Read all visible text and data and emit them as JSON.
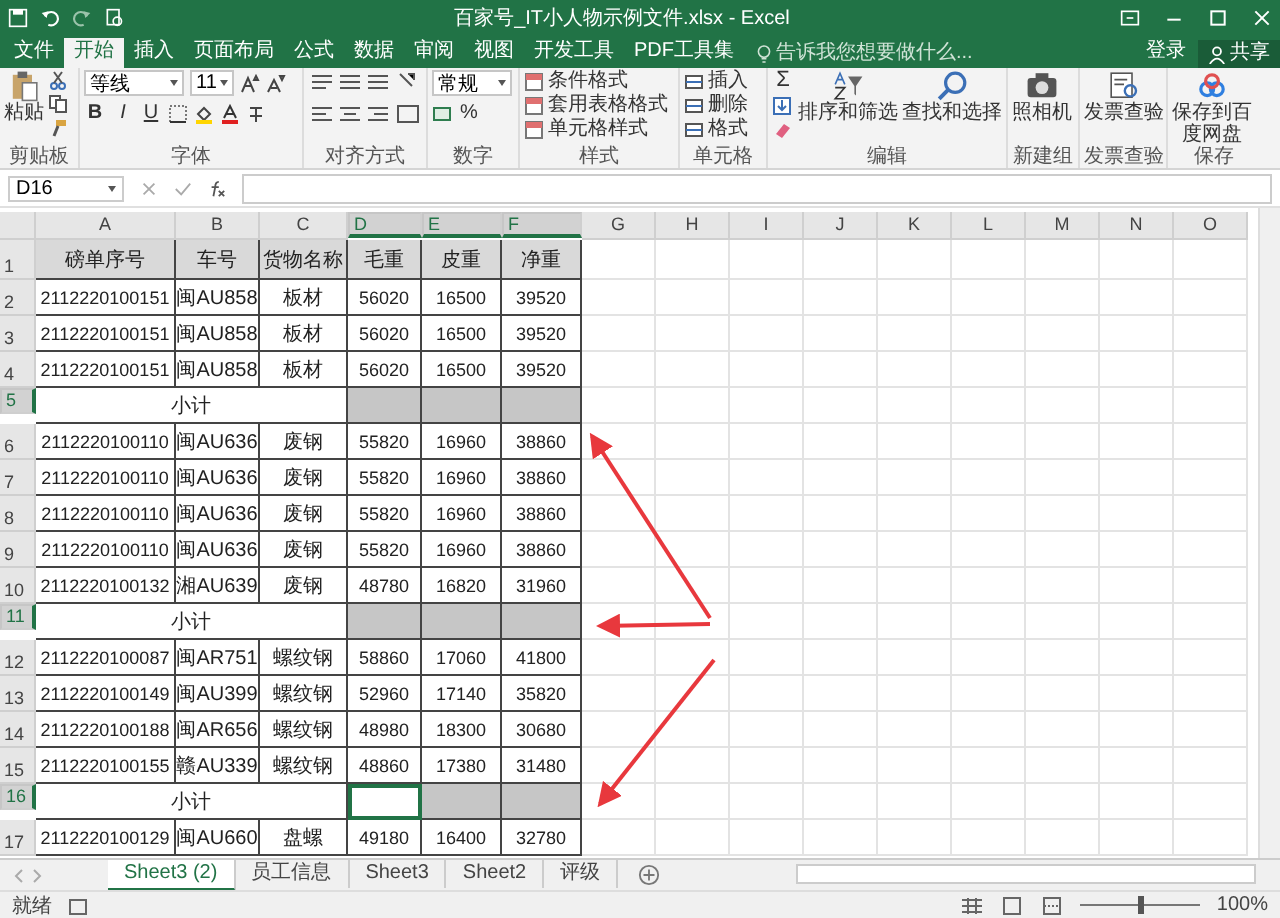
{
  "window": {
    "title": "百家号_IT小人物示例文件.xlsx - Excel"
  },
  "tabs": [
    {
      "label": "文件",
      "selected": false
    },
    {
      "label": "开始",
      "selected": true
    },
    {
      "label": "插入",
      "selected": false
    },
    {
      "label": "页面布局",
      "selected": false
    },
    {
      "label": "公式",
      "selected": false
    },
    {
      "label": "数据",
      "selected": false
    },
    {
      "label": "审阅",
      "selected": false
    },
    {
      "label": "视图",
      "selected": false
    },
    {
      "label": "开发工具",
      "selected": false
    },
    {
      "label": "PDF工具集",
      "selected": false
    }
  ],
  "tell_me": {
    "placeholder": "告诉我您想要做什么..."
  },
  "account": {
    "sign_in": "登录",
    "share": "共享"
  },
  "ribbon": {
    "clipboard": {
      "label": "剪贴板",
      "paste": "粘贴"
    },
    "font": {
      "label": "字体",
      "family": "等线",
      "size": "11",
      "bold": "B",
      "italic": "I",
      "underline": "U"
    },
    "alignment": {
      "label": "对齐方式"
    },
    "number": {
      "label": "数字",
      "format": "常规",
      "percent": "%"
    },
    "styles": {
      "label": "样式",
      "buttons": [
        "条件格式",
        "套用表格格式",
        "单元格样式"
      ]
    },
    "cells": {
      "label": "单元格",
      "buttons": [
        "插入",
        "删除",
        "格式"
      ]
    },
    "editing": {
      "label": "编辑",
      "sum": "Σ",
      "buttons": [
        "排序和筛选",
        "查找和选择"
      ]
    },
    "new_group": {
      "label": "新建组",
      "button": "照相机"
    },
    "invoice": {
      "label": "发票查验",
      "button": "发票查验"
    },
    "save": {
      "label": "保存",
      "button": "保存到百度网盘"
    }
  },
  "formula_bar": {
    "name_box": "D16"
  },
  "sheet": {
    "columns": [
      {
        "label": "A",
        "selected": false
      },
      {
        "label": "B",
        "selected": false
      },
      {
        "label": "C",
        "selected": false
      },
      {
        "label": "D",
        "selected": true
      },
      {
        "label": "E",
        "selected": true
      },
      {
        "label": "F",
        "selected": true
      },
      {
        "label": "G",
        "selected": false
      },
      {
        "label": "H",
        "selected": false
      },
      {
        "label": "I",
        "selected": false
      },
      {
        "label": "J",
        "selected": false
      },
      {
        "label": "K",
        "selected": false
      },
      {
        "label": "L",
        "selected": false
      },
      {
        "label": "M",
        "selected": false
      },
      {
        "label": "N",
        "selected": false
      },
      {
        "label": "O",
        "selected": false
      }
    ],
    "rows": [
      {
        "row": "1",
        "kind": "header",
        "selected": false,
        "cells": [
          "磅单序号",
          "车号",
          "货物名称",
          "毛重",
          "皮重",
          "净重"
        ]
      },
      {
        "row": "2",
        "kind": "data",
        "selected": false,
        "cells": [
          "2112220100151",
          "闽AU858",
          "板材",
          "56020",
          "16500",
          "39520"
        ]
      },
      {
        "row": "3",
        "kind": "data",
        "selected": false,
        "cells": [
          "2112220100151",
          "闽AU858",
          "板材",
          "56020",
          "16500",
          "39520"
        ]
      },
      {
        "row": "4",
        "kind": "data",
        "selected": false,
        "cells": [
          "2112220100151",
          "闽AU858",
          "板材",
          "56020",
          "16500",
          "39520"
        ]
      },
      {
        "row": "5",
        "kind": "subtotal",
        "selected": true,
        "label": "小计",
        "cells": [
          {
            "selected": true,
            "active": false
          },
          {
            "selected": true,
            "active": false
          },
          {
            "selected": true,
            "active": false
          }
        ]
      },
      {
        "row": "6",
        "kind": "data",
        "selected": false,
        "cells": [
          "2112220100110",
          "闽AU636",
          "废钢",
          "55820",
          "16960",
          "38860"
        ]
      },
      {
        "row": "7",
        "kind": "data",
        "selected": false,
        "cells": [
          "2112220100110",
          "闽AU636",
          "废钢",
          "55820",
          "16960",
          "38860"
        ]
      },
      {
        "row": "8",
        "kind": "data",
        "selected": false,
        "cells": [
          "2112220100110",
          "闽AU636",
          "废钢",
          "55820",
          "16960",
          "38860"
        ]
      },
      {
        "row": "9",
        "kind": "data",
        "selected": false,
        "cells": [
          "2112220100110",
          "闽AU636",
          "废钢",
          "55820",
          "16960",
          "38860"
        ]
      },
      {
        "row": "10",
        "kind": "data",
        "selected": false,
        "cells": [
          "2112220100132",
          "湘AU639",
          "废钢",
          "48780",
          "16820",
          "31960"
        ]
      },
      {
        "row": "11",
        "kind": "subtotal",
        "selected": true,
        "label": "小计",
        "cells": [
          {
            "selected": true,
            "active": false
          },
          {
            "selected": true,
            "active": false
          },
          {
            "selected": true,
            "active": false
          }
        ]
      },
      {
        "row": "12",
        "kind": "data",
        "selected": false,
        "cells": [
          "2112220100087",
          "闽AR751",
          "螺纹钢",
          "58860",
          "17060",
          "41800"
        ]
      },
      {
        "row": "13",
        "kind": "data",
        "selected": false,
        "cells": [
          "2112220100149",
          "闽AU399",
          "螺纹钢",
          "52960",
          "17140",
          "35820"
        ]
      },
      {
        "row": "14",
        "kind": "data",
        "selected": false,
        "cells": [
          "2112220100188",
          "闽AR656",
          "螺纹钢",
          "48980",
          "18300",
          "30680"
        ]
      },
      {
        "row": "15",
        "kind": "data",
        "selected": false,
        "cells": [
          "2112220100155",
          "赣AU339",
          "螺纹钢",
          "48860",
          "17380",
          "31480"
        ]
      },
      {
        "row": "16",
        "kind": "subtotal",
        "selected": true,
        "label": "小计",
        "cells": [
          {
            "selected": true,
            "active": true
          },
          {
            "selected": true,
            "active": false
          },
          {
            "selected": true,
            "active": false
          }
        ]
      },
      {
        "row": "17",
        "kind": "data",
        "selected": false,
        "cells": [
          "2112220100129",
          "闽AU660",
          "盘螺",
          "49180",
          "16400",
          "32780"
        ]
      }
    ]
  },
  "sheet_tabs": [
    {
      "label": "Sheet3 (2)",
      "selected": true
    },
    {
      "label": "员工信息",
      "selected": false
    },
    {
      "label": "Sheet3",
      "selected": false
    },
    {
      "label": "Sheet2",
      "selected": false
    },
    {
      "label": "评级",
      "selected": false
    }
  ],
  "status_bar": {
    "status": "就绪",
    "zoom": "100%",
    "level": 0.5
  }
}
